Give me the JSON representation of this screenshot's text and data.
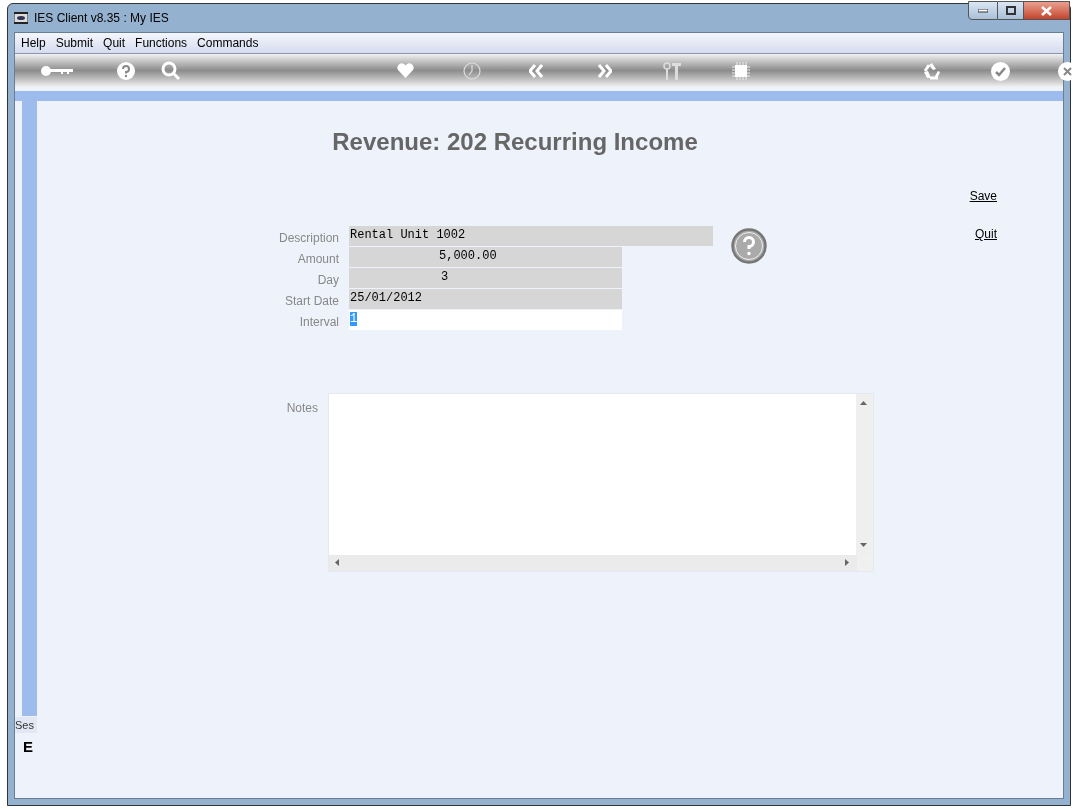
{
  "window": {
    "title": "IES Client v8.35 : My IES"
  },
  "menu": [
    "Help",
    "Submit",
    "Quit",
    "Functions",
    "Commands"
  ],
  "form": {
    "title": "Revenue: 202 Recurring Income",
    "fields": [
      {
        "label": "Description",
        "value": "Rental Unit 1002",
        "kind": "text",
        "focused": false
      },
      {
        "label": "Amount",
        "value": "5,000.00",
        "kind": "amount",
        "focused": false
      },
      {
        "label": "Day",
        "value": "3",
        "kind": "number",
        "focused": false
      },
      {
        "label": "Start Date",
        "value": "25/01/2012",
        "kind": "date",
        "focused": false
      },
      {
        "label": "Interval",
        "value": "1",
        "kind": "number_short",
        "focused": true
      }
    ],
    "notes": {
      "label": "Notes"
    },
    "actions": [
      "Save",
      "Quit"
    ]
  },
  "session_panel": {
    "label": "Ses",
    "glyph": "E"
  }
}
